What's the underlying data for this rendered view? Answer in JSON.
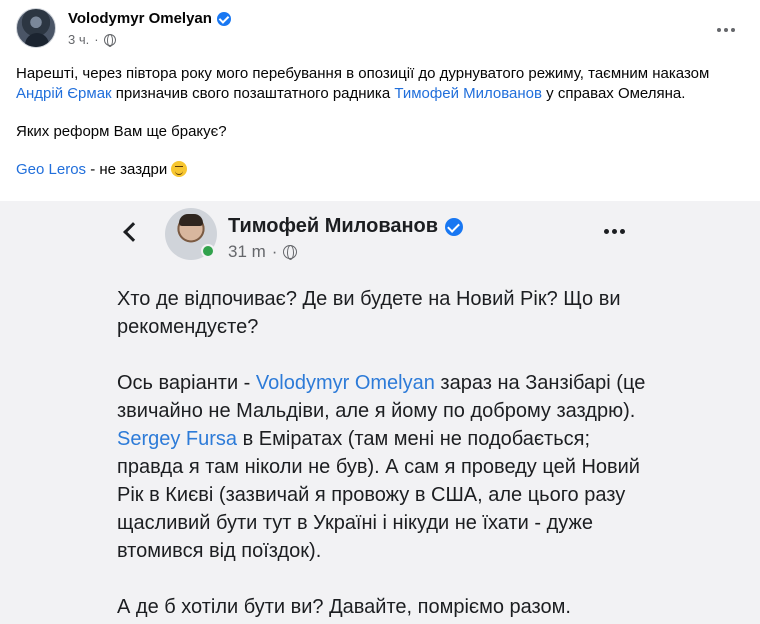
{
  "post": {
    "author": "Volodymyr Omelyan",
    "time": "3 ч.",
    "text_p1_a": "Нарешті, через півтора року мого перебування в опозиції до дурнуватого режиму, таємним наказом ",
    "link_yermak": "Андрій Єрмак",
    "text_p1_b": " призначив свого позаштатного радника ",
    "link_milovanov": "Тимофей Милованов",
    "text_p1_c": " у справах Омеляна.",
    "text_p2": "Яких реформ Вам ще бракує?",
    "link_leros": "Geo Leros",
    "text_p3": " - не заздри "
  },
  "shared_post": {
    "author": "Тимофей Милованов",
    "time": "31 m",
    "para1": "Хто де відпочиває? Де ви будете на Новий Рік? Що ви рекомендуєте?",
    "para2_a": "Ось варіанти - ",
    "link_omelyan": "Volodymyr Omelyan",
    "para2_b": " зараз на Занзібарі (це звичайно не Мальдіви, але я йому по доброму заздрю). ",
    "link_fursa": "Sergey Fursa",
    "para2_c": " в Еміратах (там мені не подобається; правда я там ніколи не був).  А сам я проведу цей Новий Рік в Києві (зазвичай я провожу в США, але цього разу щасливий бути тут в Україні і нікуди не їхати - дуже втомився від поїздок).",
    "para3": "А де б хотіли бути ви? Давайте, помріємо разом."
  },
  "icons": {
    "verified": "verified-badge-icon",
    "privacy": "globe-icon",
    "more": "more-options-icon",
    "back": "back-arrow-icon",
    "emoji": "winking-face-emoji"
  },
  "colors": {
    "link": "#216fdb",
    "verified": "#1877f2",
    "online": "#31a24c",
    "image_bg": "#f2f2f4"
  }
}
